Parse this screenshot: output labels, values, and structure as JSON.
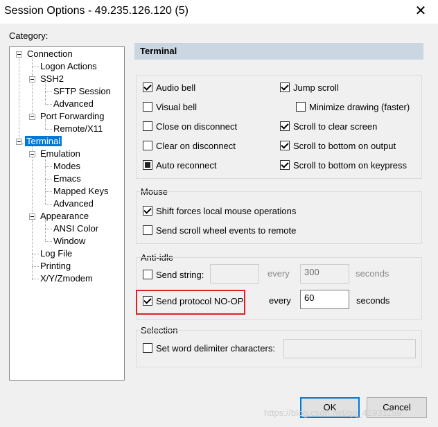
{
  "window": {
    "title": "Session Options - 49.235.126.120 (5)"
  },
  "category_label": "Category:",
  "tree": {
    "connection": "Connection",
    "logon_actions": "Logon Actions",
    "ssh2": "SSH2",
    "sftp_session": "SFTP Session",
    "ssh2_advanced": "Advanced",
    "port_forwarding": "Port Forwarding",
    "remote_x11": "Remote/X11",
    "terminal": "Terminal",
    "emulation": "Emulation",
    "modes": "Modes",
    "emacs": "Emacs",
    "mapped_keys": "Mapped Keys",
    "emulation_advanced": "Advanced",
    "appearance": "Appearance",
    "ansi_color": "ANSI Color",
    "window": "Window",
    "log_file": "Log File",
    "printing": "Printing",
    "xyz_modem": "X/Y/Zmodem"
  },
  "panel": {
    "header": "Terminal",
    "options": {
      "audio_bell": "Audio bell",
      "visual_bell": "Visual bell",
      "close_on_disconnect": "Close on disconnect",
      "clear_on_disconnect": "Clear on disconnect",
      "auto_reconnect": "Auto reconnect",
      "jump_scroll": "Jump scroll",
      "minimize_drawing": "Minimize drawing (faster)",
      "scroll_to_clear_screen": "Scroll to clear screen",
      "scroll_to_bottom_on_output": "Scroll to bottom on output",
      "scroll_to_bottom_on_keypress": "Scroll to bottom on keypress"
    },
    "mouse": {
      "legend": "Mouse",
      "shift_forces": "Shift forces local mouse operations",
      "scroll_wheel": "Send scroll wheel events to remote"
    },
    "anti_idle": {
      "legend": "Anti-idle",
      "send_string": "Send string:",
      "send_string_value": "",
      "every1": "every",
      "every1_value": "300",
      "seconds1": "seconds",
      "send_noop": "Send protocol NO-OP",
      "every2": "every",
      "every2_value": "60",
      "seconds2": "seconds"
    },
    "selection": {
      "legend": "Selection",
      "word_delimiter": "Set word delimiter characters:",
      "word_delimiter_value": ""
    }
  },
  "buttons": {
    "ok": "OK",
    "cancel": "Cancel"
  },
  "watermark": "https://blog.csdn.net/qq_41931159",
  "colors": {
    "selection": "#0078d7",
    "header_bg": "#cad6e2",
    "highlight": "#e02020"
  }
}
